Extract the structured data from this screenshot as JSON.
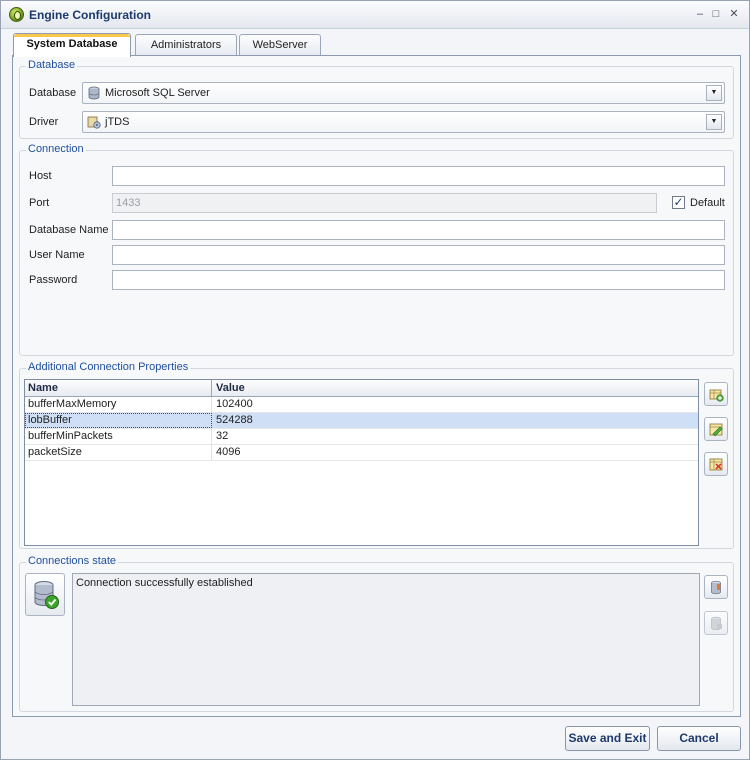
{
  "window": {
    "title": "Engine Configuration",
    "controls": {
      "minimize": "–",
      "maximize": "□",
      "close": "✕"
    }
  },
  "tabs": [
    {
      "label": "System Database",
      "active": true
    },
    {
      "label": "Administrators",
      "active": false
    },
    {
      "label": "WebServer",
      "active": false
    }
  ],
  "database_group": {
    "title": "Database",
    "database_label": "Database",
    "database_value": "Microsoft SQL Server",
    "driver_label": "Driver",
    "driver_value": "jTDS"
  },
  "connection_group": {
    "title": "Connection",
    "host_label": "Host",
    "host_value": "",
    "port_label": "Port",
    "port_value": "1433",
    "default_label": "Default",
    "default_checked": true,
    "dbname_label": "Database Name",
    "dbname_value": "",
    "username_label": "User Name",
    "username_value": "",
    "password_label": "Password",
    "password_value": ""
  },
  "properties_group": {
    "title": "Additional Connection Properties",
    "columns": [
      "Name",
      "Value"
    ],
    "rows": [
      {
        "name": "bufferMaxMemory",
        "value": "102400"
      },
      {
        "name": "lobBuffer",
        "value": "524288"
      },
      {
        "name": "bufferMinPackets",
        "value": "32"
      },
      {
        "name": "packetSize",
        "value": "4096"
      }
    ],
    "selected_row": 1
  },
  "state_group": {
    "title": "Connections state",
    "message": "Connection successfully established"
  },
  "footer": {
    "save_label": "Save and Exit",
    "cancel_label": "Cancel"
  },
  "colors": {
    "group_title": "#1f4f9f",
    "selected_row": "#cfe0f6",
    "tab_highlight": "#f7c74e"
  }
}
